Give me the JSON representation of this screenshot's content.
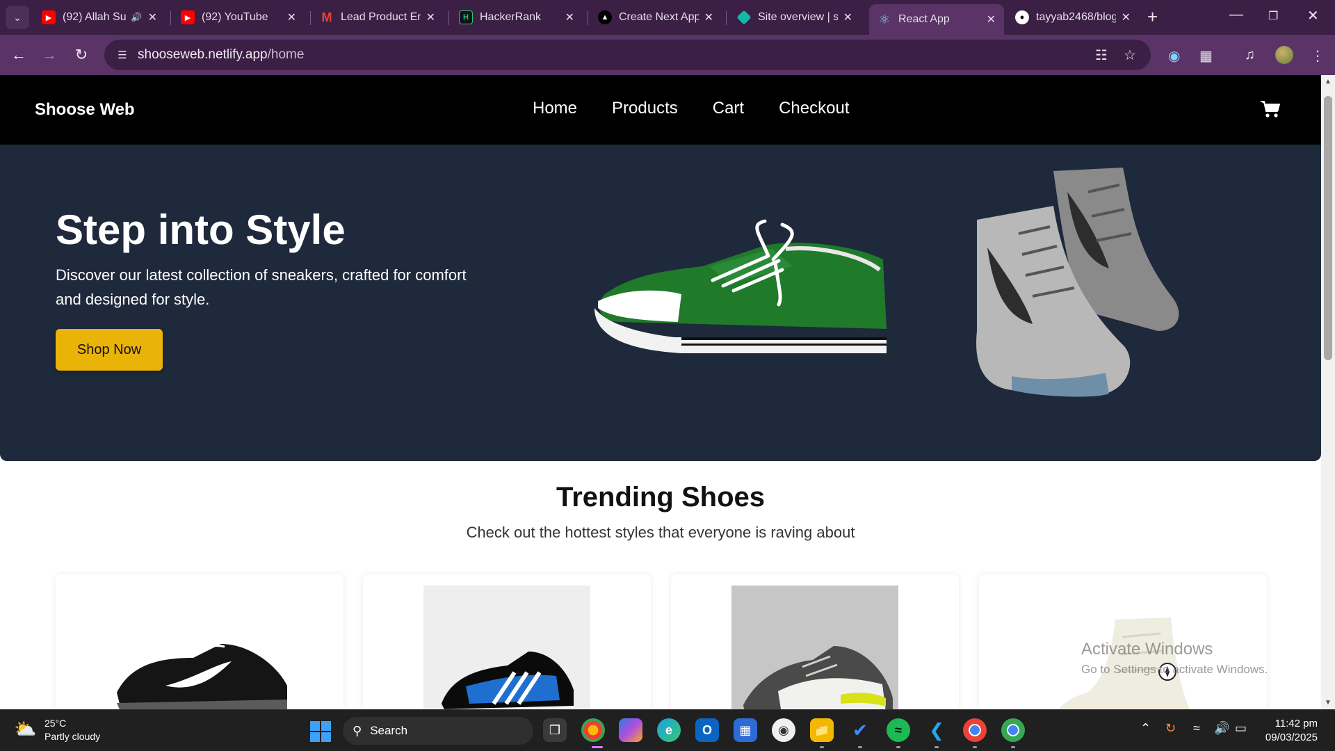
{
  "browser": {
    "tabs": [
      {
        "title": "(92) Allah Su",
        "favicon": "youtube-icon",
        "has_sound": true
      },
      {
        "title": "(92) YouTube",
        "favicon": "youtube-icon"
      },
      {
        "title": "Lead Product En",
        "favicon": "gmail-icon"
      },
      {
        "title": "HackerRank",
        "favicon": "hackerrank-icon"
      },
      {
        "title": "Create Next App",
        "favicon": "vercel-icon"
      },
      {
        "title": "Site overview | sl",
        "favicon": "netlify-icon"
      },
      {
        "title": "React App",
        "favicon": "react-icon",
        "active": true
      },
      {
        "title": "tayyab2468/blog",
        "favicon": "github-icon"
      }
    ],
    "url_host": "shooseweb.netlify.app",
    "url_path": "/home"
  },
  "site": {
    "brand": "Shoose Web",
    "nav": [
      "Home",
      "Products",
      "Cart",
      "Checkout"
    ],
    "hero": {
      "title": "Step into Style",
      "subtitle": "Discover our latest collection of sneakers, crafted for comfort and designed for style.",
      "cta": "Shop Now"
    },
    "trending": {
      "title": "Trending Shoes",
      "subtitle": "Check out the hottest styles that everyone is raving about"
    },
    "products": [
      {
        "image": "black-nike-air-max-sneaker"
      },
      {
        "image": "blue-adidas-ultraboost-sneaker"
      },
      {
        "image": "grey-puma-rs-x-sneaker"
      },
      {
        "image": "white-converse-high-top-sneaker"
      }
    ]
  },
  "watermark": {
    "line1": "Activate Windows",
    "line2": "Go to Settings to activate Windows."
  },
  "taskbar": {
    "weather_temp": "25°C",
    "weather_desc": "Partly cloudy",
    "search_label": "Search",
    "time": "11:42 pm",
    "date": "09/03/2025"
  },
  "colors": {
    "hero_bg": "#1e293b",
    "cta_bg": "#eab308",
    "nav_bg": "#000000",
    "browser_frame": "#5a3466"
  }
}
